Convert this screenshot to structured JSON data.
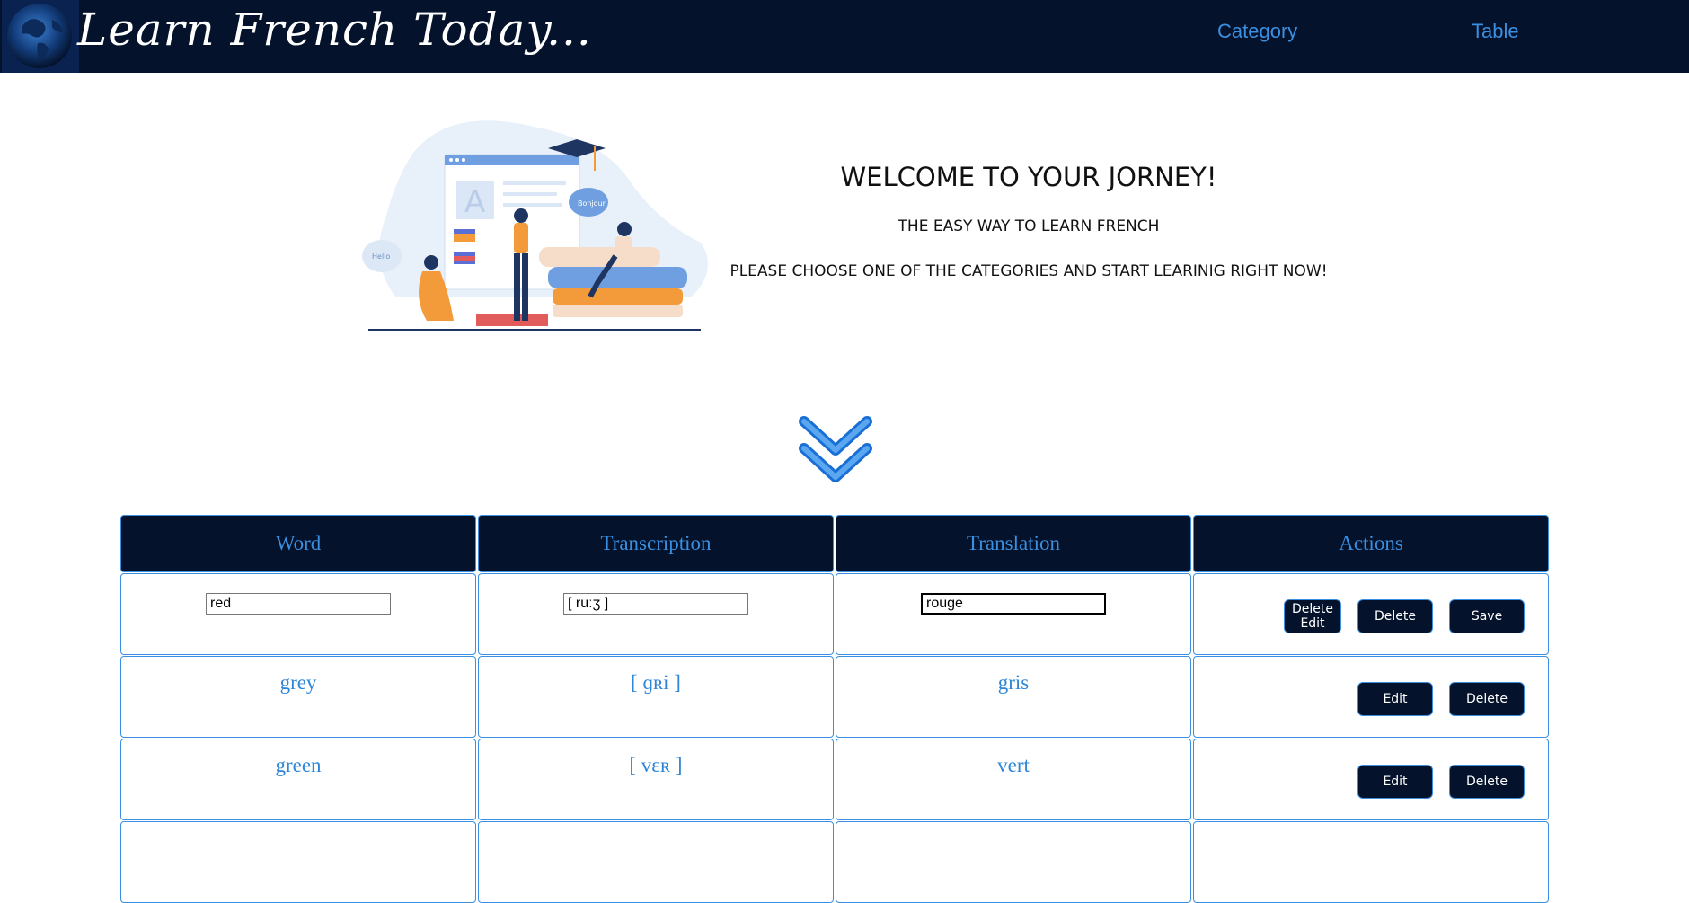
{
  "header": {
    "brand": "Learn French Today...",
    "nav": [
      {
        "label": "Category"
      },
      {
        "label": "Table"
      }
    ]
  },
  "hero": {
    "title": "WELCOME TO YOUR JORNEY!",
    "subtitle": "THE EASY WAY TO LEARN FRENCH",
    "line": "PLEASE CHOOSE ONE OF THE CATEGORIES AND START LEARINIG RIGHT NOW!",
    "illustration_bubbles": [
      "Hello",
      "Bonjour"
    ],
    "illustration_letter": "A"
  },
  "table": {
    "columns": [
      "Word",
      "Transcription",
      "Translation",
      "Actions"
    ],
    "edit_row": {
      "word": "red",
      "transcription": "[ ruːʒ ]",
      "translation": "rouge",
      "buttons": {
        "delete_edit_line1": "Delete",
        "delete_edit_line2": "Edit",
        "delete": "Delete",
        "save": "Save"
      }
    },
    "rows": [
      {
        "word": "grey",
        "transcription": "[ ɡʀi ]",
        "translation": "gris",
        "edit": "Edit",
        "delete": "Delete"
      },
      {
        "word": "green",
        "transcription": "[ vɛʀ ]",
        "translation": "vert",
        "edit": "Edit",
        "delete": "Delete"
      }
    ]
  },
  "colors": {
    "header_bg": "#04122b",
    "accent": "#3a8fe0",
    "text_blue": "#2f86d6"
  }
}
